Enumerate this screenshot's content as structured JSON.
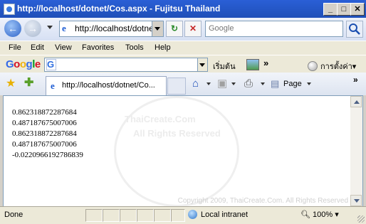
{
  "window": {
    "title": "http://localhost/dotnet/Cos.aspx - Fujitsu Thailand"
  },
  "controls": {
    "minimize": "_",
    "maximize": "□",
    "close": "✕"
  },
  "nav": {
    "back_icon": "back-arrow-icon",
    "forward_icon": "forward-arrow-icon",
    "address": "http://localhost/dotne",
    "refresh_glyph": "↻",
    "stop_glyph": "✕",
    "search_placeholder": "Google",
    "search_icon": "magnifier-icon"
  },
  "menu": [
    "File",
    "Edit",
    "View",
    "Favorites",
    "Tools",
    "Help"
  ],
  "google_toolbar": {
    "logo": "Google",
    "search_label": "เริ่มต้น",
    "more": "»",
    "settings_label": "การตั้งค่า▾"
  },
  "tab": {
    "title": "http://localhost/dotnet/Co..."
  },
  "command_bar": {
    "page_label": "Page",
    "more": "»"
  },
  "content": {
    "lines": [
      "0.862318872287684",
      "0.487187675007006",
      "0.862318872287684",
      "0.487187675007006",
      "-0.0220966192786839"
    ],
    "watermark_line1": "ThaiCreate.Com",
    "watermark_line2": "All Rights Reserved",
    "copyright": "Copyright 2009, ThaiCreate.Com. All Rights Reserved"
  },
  "status": {
    "text": "Done",
    "zone": "Local intranet",
    "zoom": "100%"
  },
  "colors": {
    "titlebar": "#1f4fb8",
    "chrome": "#ece9d8"
  }
}
